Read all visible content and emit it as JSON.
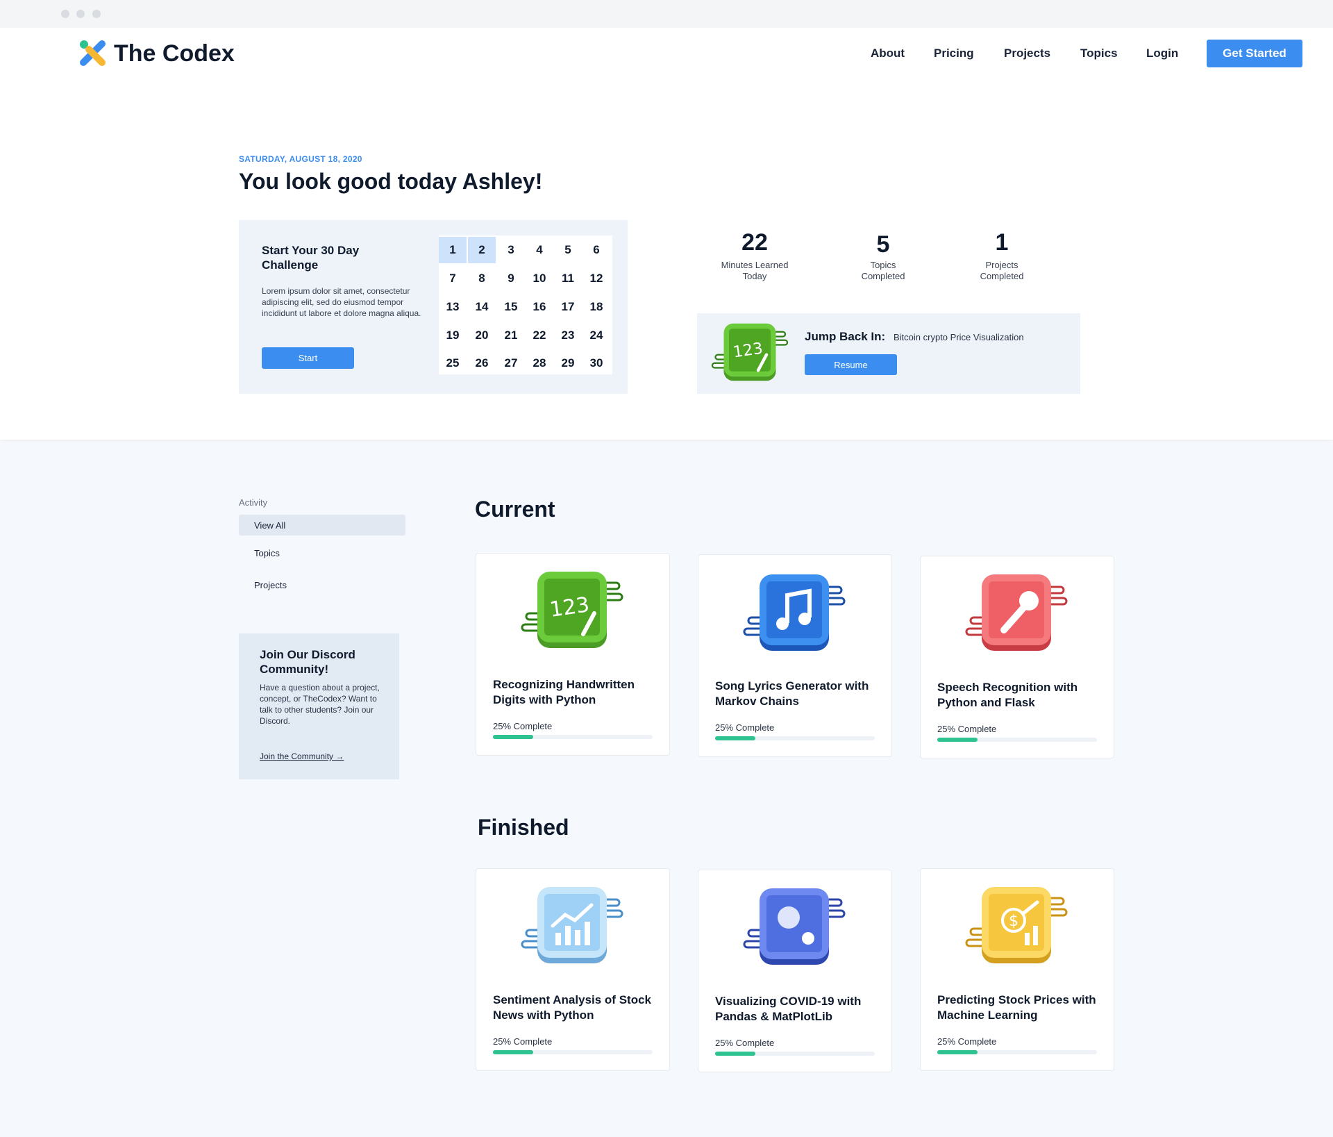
{
  "brand": {
    "name": "The Codex"
  },
  "nav": {
    "items": [
      "About",
      "Pricing",
      "Projects",
      "Topics",
      "Login"
    ],
    "cta": "Get Started"
  },
  "header": {
    "date": "SATURDAY, AUGUST 18, 2020",
    "greeting": "You look good today Ashley!"
  },
  "challenge": {
    "title": "Start Your 30 Day Challenge",
    "description": "Lorem ipsum dolor sit amet, consectetur adipiscing elit, sed do eiusmod tempor incididunt ut labore et dolore magna aliqua.",
    "start_label": "Start",
    "days": [
      "1",
      "2",
      "3",
      "4",
      "5",
      "6",
      "7",
      "8",
      "9",
      "10",
      "11",
      "12",
      "13",
      "14",
      "15",
      "16",
      "17",
      "18",
      "19",
      "20",
      "21",
      "22",
      "23",
      "24",
      "25",
      "26",
      "27",
      "28",
      "29",
      "30"
    ],
    "active_days": [
      1,
      2
    ]
  },
  "stats": [
    {
      "value": "22",
      "label": "Minutes Learned Today"
    },
    {
      "value": "5",
      "label": "Topics Completed"
    },
    {
      "value": "1",
      "label": "Projects Completed"
    }
  ],
  "jump_back": {
    "title": "Jump Back In:",
    "project": "Bitcoin crypto Price Visualization",
    "resume_label": "Resume",
    "icon": "numbers-chalkboard-icon"
  },
  "sidebar": {
    "heading": "Activity",
    "filters": [
      "View All",
      "Topics",
      "Projects"
    ],
    "selected": "View All"
  },
  "discord": {
    "title": "Join Our Discord Community!",
    "description": "Have a question about a project, concept, or TheCodex? Want to talk to other students? Join our Discord.",
    "link": "Join the Community →"
  },
  "sections": {
    "current": "Current",
    "finished": "Finished"
  },
  "current_projects": [
    {
      "title": "Recognizing Handwritten Digits with Python",
      "progress_label": "25% Complete",
      "progress": 0.25,
      "icon": "numbers-chalkboard-icon",
      "color": "#5bb52e"
    },
    {
      "title": "Song Lyrics Generator with Markov Chains",
      "progress_label": "25% Complete",
      "progress": 0.25,
      "icon": "music-note-icon",
      "color": "#2f7ee0"
    },
    {
      "title": "Speech Recognition with Python and Flask",
      "progress_label": "25% Complete",
      "progress": 0.25,
      "icon": "microphone-icon",
      "color": "#ef6468"
    }
  ],
  "finished_projects": [
    {
      "title": "Sentiment Analysis of Stock News with Python",
      "progress_label": "25% Complete",
      "progress": 0.25,
      "icon": "chart-growth-icon",
      "color": "#9fd0f5"
    },
    {
      "title": "Visualizing COVID-19 with Pandas & MatPlotLib",
      "progress_label": "25% Complete",
      "progress": 0.25,
      "icon": "virus-icon",
      "color": "#4f6fe0"
    },
    {
      "title": "Predicting Stock Prices with Machine Learning",
      "progress_label": "25% Complete",
      "progress": 0.25,
      "icon": "dollar-growth-icon",
      "color": "#f7c63f"
    }
  ],
  "colors": {
    "accent": "#3b8eef",
    "progress": "#2fc291",
    "heading": "#0f1b2d"
  }
}
